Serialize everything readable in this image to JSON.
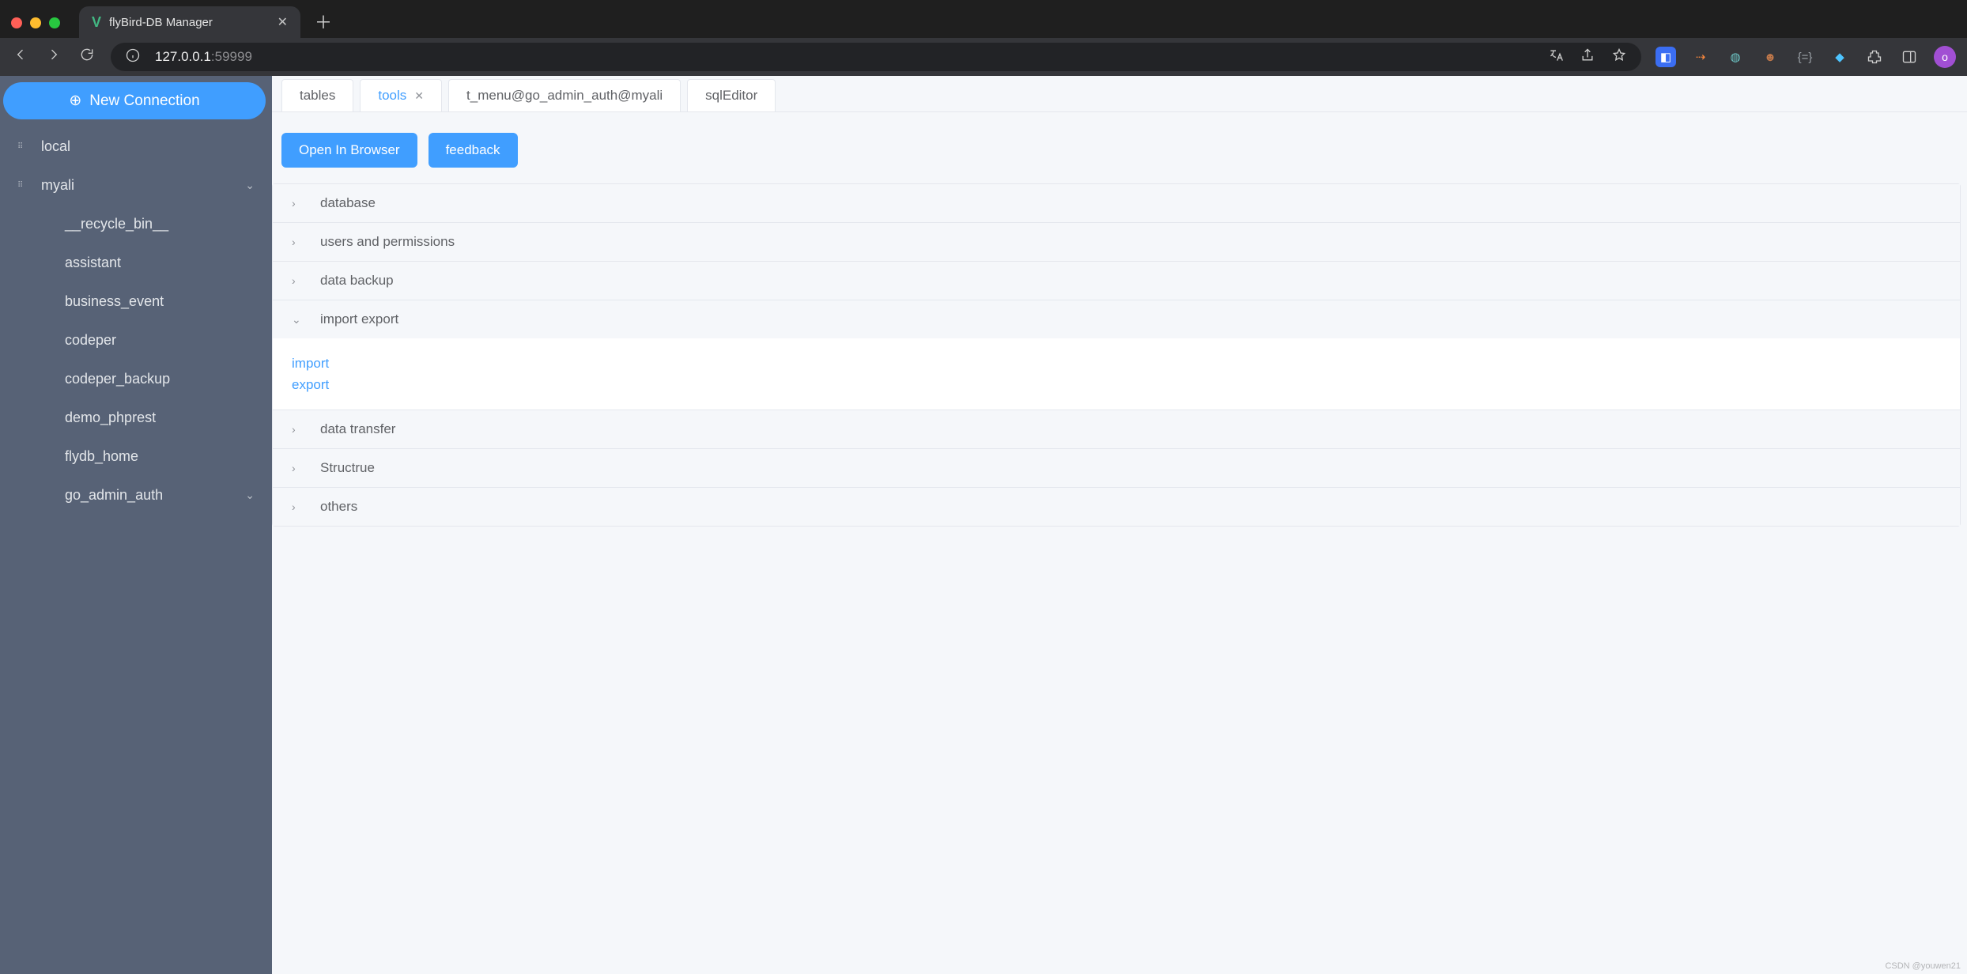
{
  "browser": {
    "tab_title": "flyBird-DB Manager",
    "url_host": "127.0.0.1",
    "url_port": ":59999",
    "avatar_letter": "o"
  },
  "sidebar": {
    "new_connection": "New Connection",
    "connections": [
      {
        "name": "local",
        "expanded": false
      },
      {
        "name": "myali",
        "expanded": true
      }
    ],
    "databases": [
      {
        "name": "__recycle_bin__"
      },
      {
        "name": "assistant"
      },
      {
        "name": "business_event"
      },
      {
        "name": "codeper"
      },
      {
        "name": "codeper_backup"
      },
      {
        "name": "demo_phprest"
      },
      {
        "name": "flydb_home"
      },
      {
        "name": "go_admin_auth",
        "has_children": true
      }
    ]
  },
  "tabs": [
    {
      "label": "tables",
      "active": false,
      "closable": false
    },
    {
      "label": "tools",
      "active": true,
      "closable": true
    },
    {
      "label": "t_menu@go_admin_auth@myali",
      "active": false,
      "closable": false
    },
    {
      "label": "sqlEditor",
      "active": false,
      "closable": false
    }
  ],
  "toolbar": {
    "open_browser": "Open In Browser",
    "feedback": "feedback"
  },
  "accordion": [
    {
      "title": "database",
      "open": false
    },
    {
      "title": "users and permissions",
      "open": false
    },
    {
      "title": "data backup",
      "open": false
    },
    {
      "title": "import export",
      "open": true,
      "items": [
        "import",
        "export"
      ]
    },
    {
      "title": "data transfer",
      "open": false
    },
    {
      "title": "Structrue",
      "open": false
    },
    {
      "title": "others",
      "open": false
    }
  ],
  "watermark": "CSDN @youwen21"
}
